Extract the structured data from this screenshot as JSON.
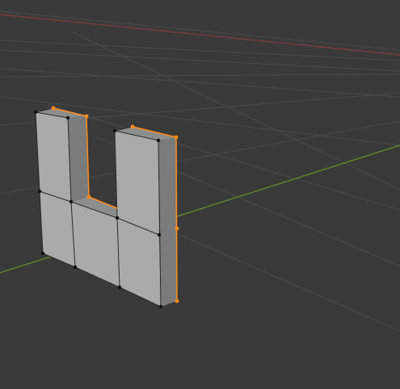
{
  "viewport": {
    "background": "#3a3a3a",
    "grid_color": "#4a4a4a",
    "x_axis_color": "#7a3b3f",
    "y_axis_color": "#5f8a2e"
  },
  "mesh": {
    "face_light": "#a9aaaa",
    "face_side": "#7a7b7b",
    "face_shadow": "#8c8d8d",
    "edge_color": "#2a2a2a",
    "selected_color": "#ff8c1a",
    "vertex_color": "#101010"
  }
}
